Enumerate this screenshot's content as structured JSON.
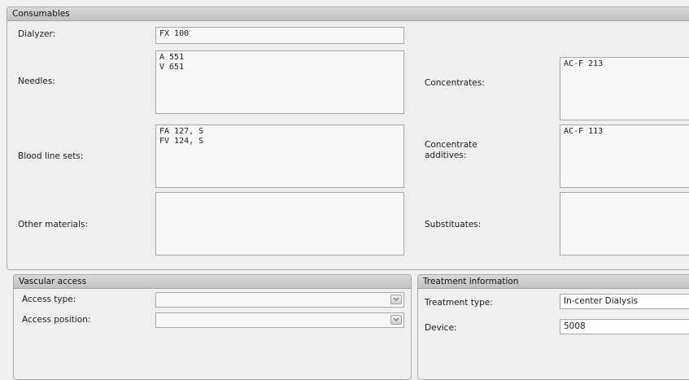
{
  "consumables": {
    "header": "Consumables",
    "dialyzer": {
      "label": "Dialyzer:",
      "value": "FX 100"
    },
    "needles": {
      "label": "Needles:",
      "value": "A 551\nV 651"
    },
    "blood_line_sets": {
      "label": "Blood line sets:",
      "value": "FA 127, S\nFV 124, S"
    },
    "other_materials": {
      "label": "Other materials:",
      "value": ""
    },
    "concentrates": {
      "label": "Concentrates:",
      "value": "AC-F 213"
    },
    "concentrate_additives": {
      "label": "Concentrate\nadditives:",
      "value": "AC-F 113"
    },
    "substituates": {
      "label": "Substituates:",
      "value": ""
    }
  },
  "vascular_access": {
    "header": "Vascular access",
    "access_type": {
      "label": "Access type:",
      "value": ""
    },
    "access_position": {
      "label": "Access position:",
      "value": ""
    }
  },
  "treatment_information": {
    "header": "Treatment information",
    "treatment_type": {
      "label": "Treatment type:",
      "value": "In-center Dialysis"
    },
    "device": {
      "label": "Device:",
      "value": "5008"
    }
  },
  "icons": {
    "dropdown": "chevron-down-icon"
  }
}
